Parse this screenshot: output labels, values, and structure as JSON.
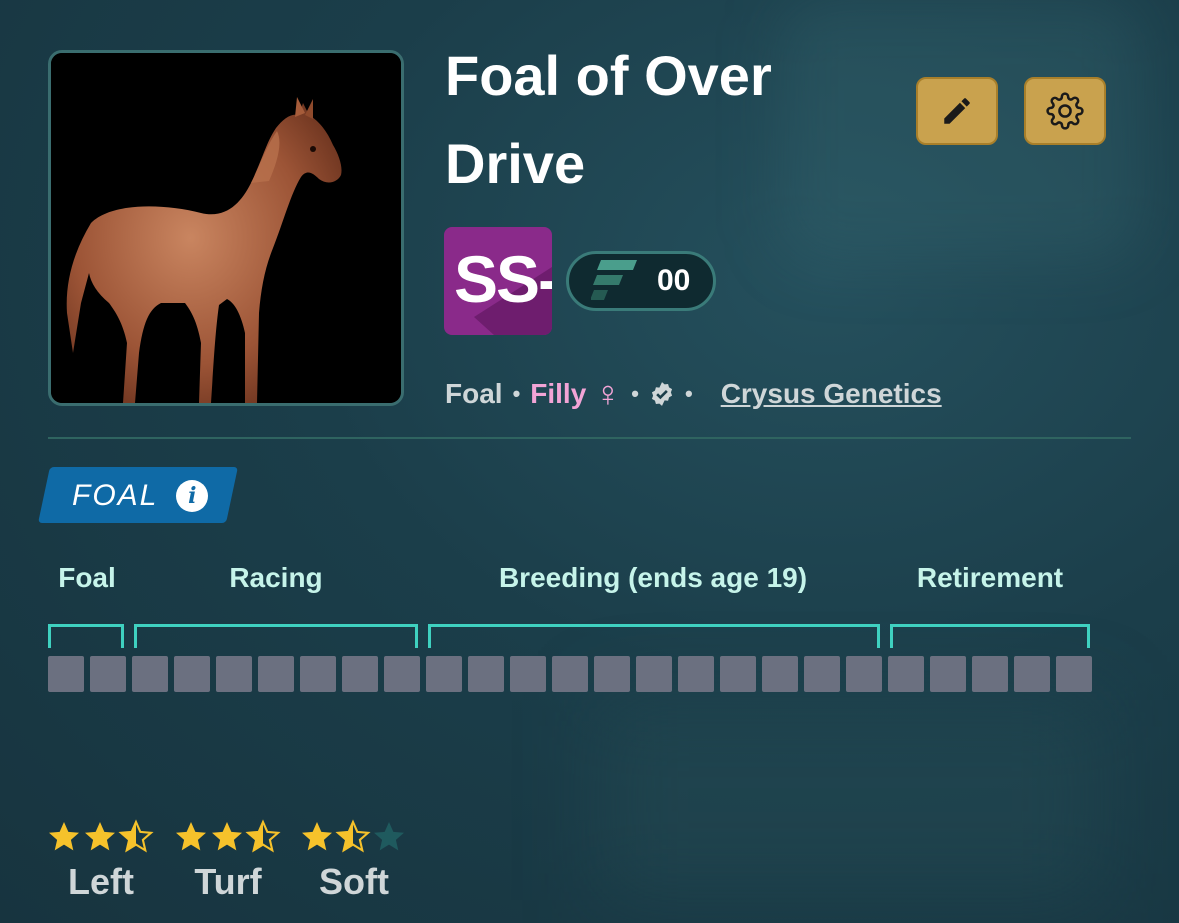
{
  "horse": {
    "name": "Foal of Over Drive",
    "grade": "SS-",
    "token_count": "00",
    "age_stage": "Foal",
    "gender": "Filly",
    "gender_symbol": "♀",
    "breeder_link": "Crysus Genetics",
    "separator": "•"
  },
  "stage_badge": {
    "label": "FOAL",
    "info_glyph": "i"
  },
  "lifecycle": {
    "phases": [
      {
        "label": "Foal",
        "cells": 2
      },
      {
        "label": "Racing",
        "cells": 7
      },
      {
        "label": "Breeding (ends age 19)",
        "cells": 11
      },
      {
        "label": "Retirement",
        "cells": 5
      }
    ],
    "cell_color": "#6b7080",
    "bracket_color": "#3fd1c0"
  },
  "preferences": [
    {
      "label": "Left",
      "stars": 2.5,
      "max": 3
    },
    {
      "label": "Turf",
      "stars": 2.5,
      "max": 3
    },
    {
      "label": "Soft",
      "stars": 1.5,
      "max": 3
    }
  ],
  "icons": {
    "edit": "pencil-icon",
    "settings": "gear-icon",
    "verified": "verified-badge-icon",
    "info": "info-icon",
    "token": "token-logo-icon"
  },
  "colors": {
    "accent_gold": "#c9a24e",
    "grade_purple": "#8a2a8a",
    "filly_pink": "#f2a4d6",
    "badge_blue": "#0f6aa6",
    "star_gold": "#f6c22b",
    "star_empty": "#1f5a5e"
  }
}
